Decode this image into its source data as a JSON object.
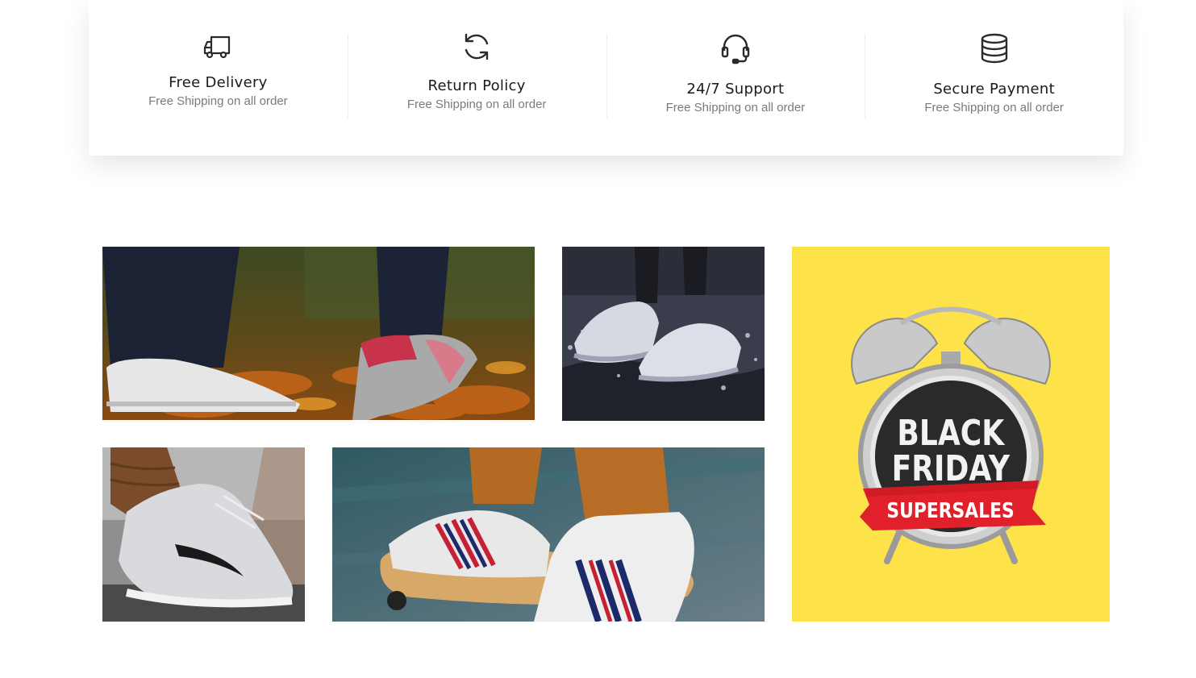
{
  "features": [
    {
      "title": "Free Delivery",
      "subtitle": "Free Shipping on all order",
      "icon": "truck-icon"
    },
    {
      "title": "Return Policy",
      "subtitle": "Free Shipping on all order",
      "icon": "refresh-icon"
    },
    {
      "title": "24/7 Support",
      "subtitle": "Free Shipping on all order",
      "icon": "headset-icon"
    },
    {
      "title": "Secure Payment",
      "subtitle": "Free Shipping on all order",
      "icon": "coins-stack-icon"
    }
  ],
  "banner": {
    "line1": "BLACK",
    "line2": "FRIDAY",
    "ribbon": "SUPERSALES",
    "background_color": "#fde24a",
    "ribbon_color": "#e0202a"
  }
}
